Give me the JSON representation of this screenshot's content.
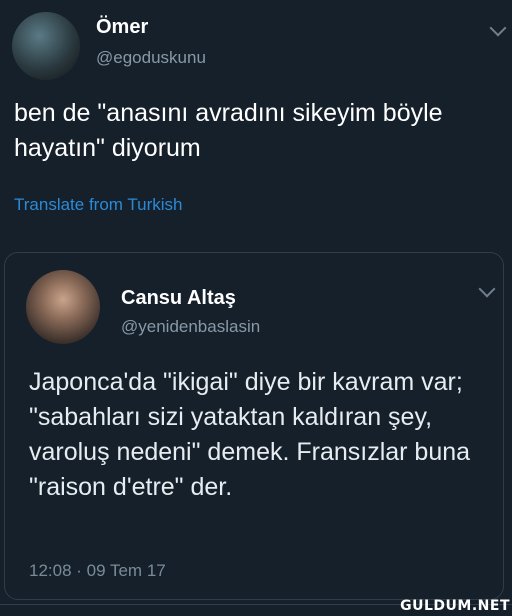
{
  "tweet": {
    "name": "Ömer",
    "handle": "@egoduskunu",
    "text": "ben de \"anasını avradını sikeyim böyle hayatın\" diyorum",
    "translate_label": "Translate from Turkish",
    "avatar_icon": "user-avatar-icon",
    "menu_icon": "chevron-down-icon"
  },
  "quoted_tweet": {
    "name": "Cansu Altaş",
    "handle": "@yenidenbaslasin",
    "text": "Japonca'da \"ikigai\" diye bir kavram var; \"sabahları sizi yataktan kaldıran şey, varoluş nedeni\" demek. Fransızlar buna \"raison d'etre\" der.",
    "timestamp": "12:08 · 09 Tem 17",
    "avatar_icon": "user-avatar-icon",
    "menu_icon": "chevron-down-icon"
  },
  "watermark": "GULDUM.NET",
  "colors": {
    "background": "#15202b",
    "link": "#2b8ad8",
    "secondary_text": "#8899a6"
  }
}
